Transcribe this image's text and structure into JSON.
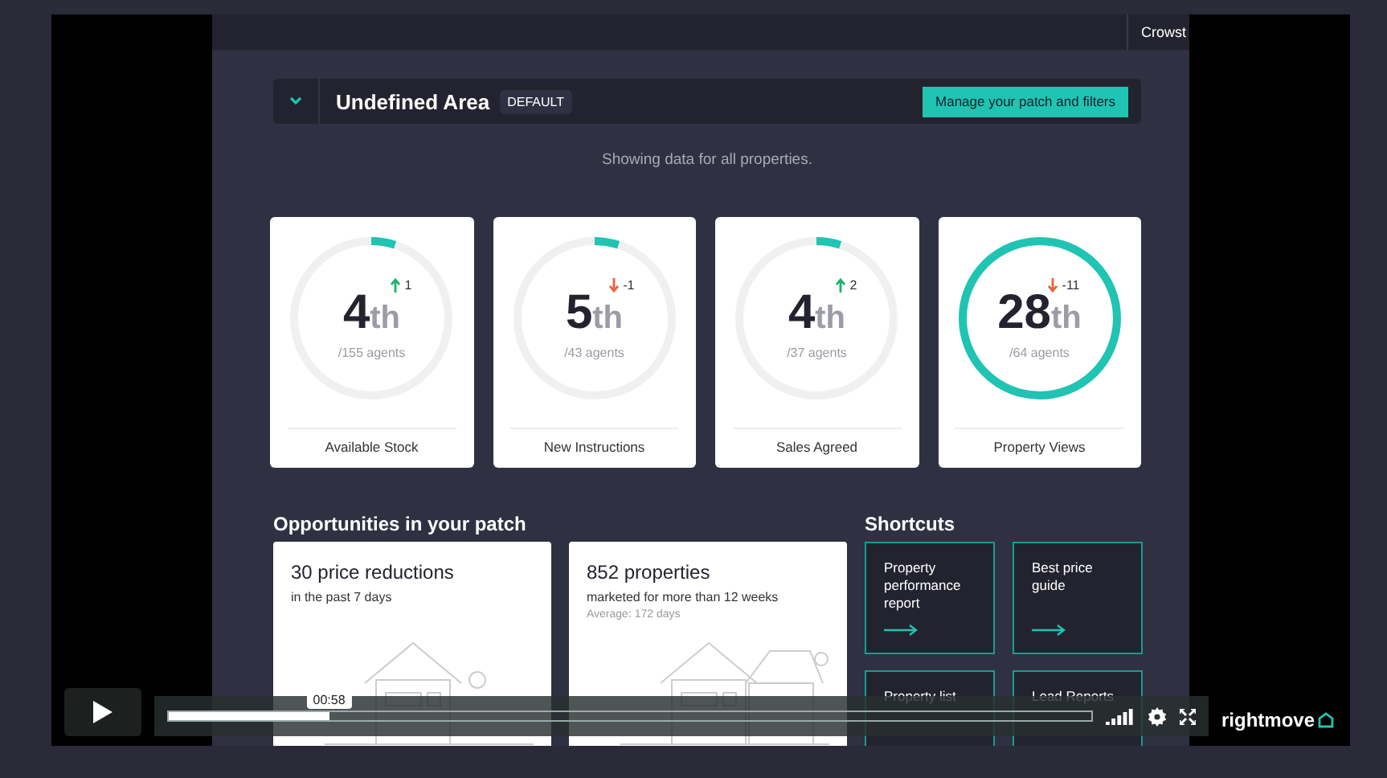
{
  "top_bar": {
    "user": "Crowst"
  },
  "area": {
    "name": "Undefined Area",
    "badge": "DEFAULT",
    "button": "Manage your patch and filters"
  },
  "note": "Showing data for all properties.",
  "stats": [
    {
      "rank": "4",
      "suffix": "th",
      "change": "1",
      "rising": true,
      "total": "/155 agents",
      "label": "Available Stock",
      "level": 0.05
    },
    {
      "rank": "5",
      "suffix": "th",
      "change": "-1",
      "rising": false,
      "total": "/43 agents",
      "label": "New Instructions",
      "level": 0.05
    },
    {
      "rank": "4",
      "suffix": "th",
      "change": "2",
      "rising": true,
      "total": "/37 agents",
      "label": "Sales Agreed",
      "level": 0.05
    },
    {
      "rank": "28",
      "suffix": "th",
      "change": "-11",
      "rising": false,
      "total": "/64 agents",
      "label": "Property Views",
      "level": 1
    }
  ],
  "opportunities": {
    "title": "Opportunities in your patch",
    "cards": [
      {
        "title": "30 price reductions",
        "subtitle": "in the past 7 days"
      },
      {
        "title": "852 properties",
        "subtitle": "marketed for more than 12 weeks",
        "note": "Average: 172 days"
      }
    ]
  },
  "shortcuts": {
    "title": "Shortcuts",
    "items": [
      {
        "label": "Property performance report"
      },
      {
        "label": "Best price guide"
      },
      {
        "label": "Property list"
      },
      {
        "label": "Lead Reports"
      }
    ]
  },
  "video": {
    "time": "00:58",
    "level": 0.175,
    "logo": "rightmove"
  }
}
